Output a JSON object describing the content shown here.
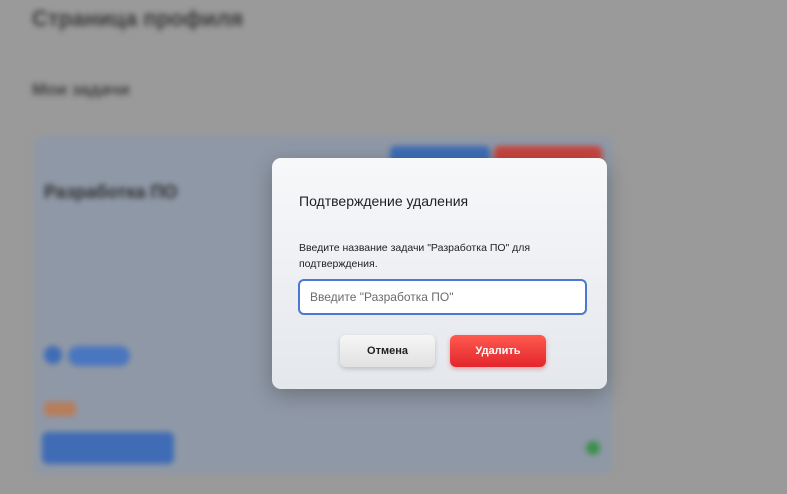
{
  "background_page": {
    "page_title": "Страница профиля",
    "section_title": "Мои задачи",
    "task_card": {
      "title": "Разработка ПО"
    }
  },
  "modal": {
    "title": "Подтверждение удаления",
    "text": "Введите название задачи \"Разработка ПО\" для подтверждения.",
    "input_value": "",
    "input_placeholder": "Введите \"Разработка ПО\"",
    "cancel_label": "Отмена",
    "delete_label": "Удалить"
  },
  "colors": {
    "accent_blue": "#4b78d1",
    "danger_red": "#e3262c",
    "overlay": "#9a9a9a"
  }
}
